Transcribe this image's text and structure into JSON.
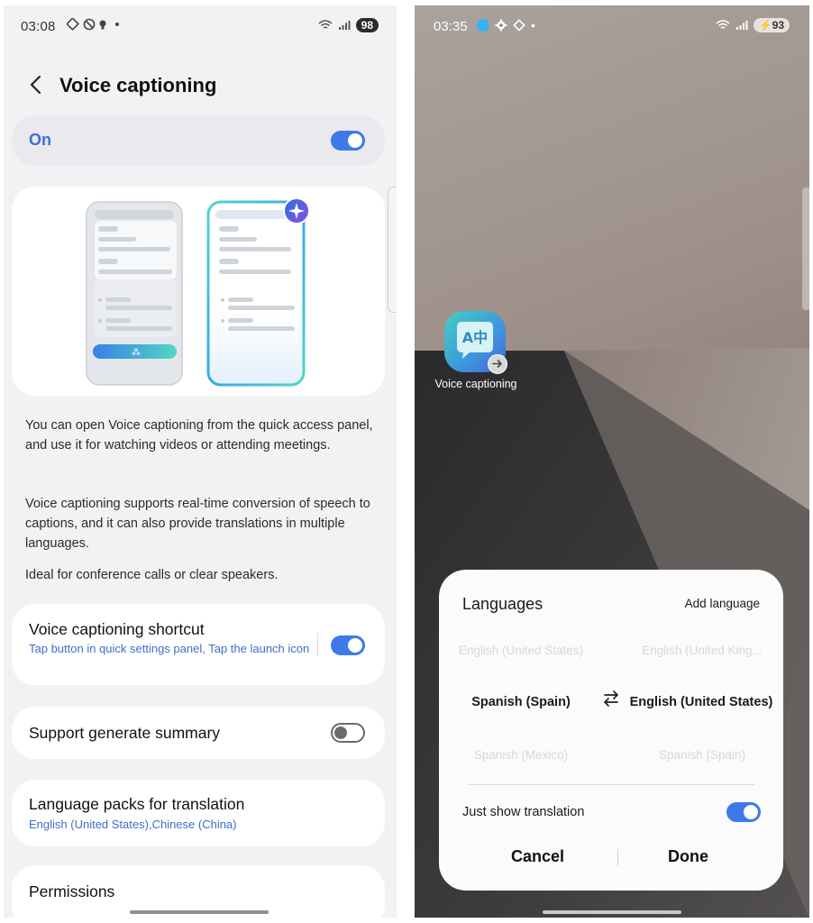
{
  "left": {
    "status": {
      "time": "03:08",
      "icons": "⊕ ⊗ ●",
      "dot": "•",
      "battery": "98"
    },
    "title": "Voice captioning",
    "master_toggle": {
      "label": "On",
      "state": "on"
    },
    "descriptions": [
      "You can open Voice captioning from the quick access panel, and use it for watching videos or attending meetings.",
      "Voice captioning supports real-time conversion of speech to captions, and it can also provide translations in multiple languages.",
      "Ideal for conference calls or clear speakers."
    ],
    "settings": [
      {
        "title": "Voice captioning shortcut",
        "subtitle": "Tap button in quick settings panel, Tap the launch icon",
        "toggle": "on"
      },
      {
        "title": "Support generate summary",
        "toggle": "off"
      },
      {
        "title": "Language packs for translation",
        "subtitle": "English (United States),Chinese (China)"
      },
      {
        "title": "Permissions"
      }
    ]
  },
  "right": {
    "status": {
      "time": "03:35",
      "battery": "93",
      "dot": "•"
    },
    "app_icon": {
      "label": "Voice captioning",
      "glyph": "A中"
    },
    "sheet": {
      "title": "Languages",
      "add_language": "Add language",
      "source_above": "English (United States)",
      "target_above": "English (United King...",
      "source_selected": "Spanish (Spain)",
      "target_selected": "English (United States)",
      "source_below": "Spanish (Mexico)",
      "target_below": "Spanish (Spain)",
      "just_show_translation": "Just show translation",
      "just_show_state": "on",
      "cancel": "Cancel",
      "done": "Done"
    }
  },
  "colors": {
    "accent": "#3e79e8",
    "link": "#3d6fc7"
  }
}
